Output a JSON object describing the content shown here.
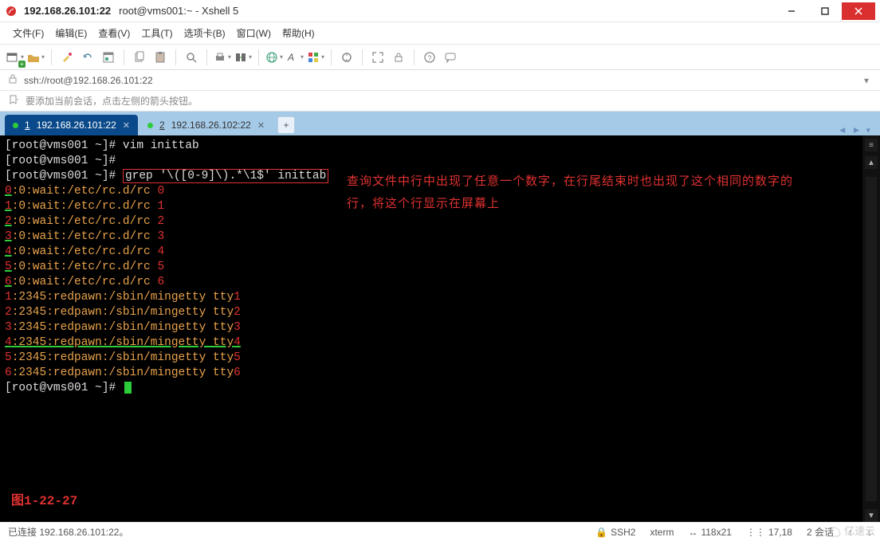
{
  "window": {
    "ip_bold": "192.168.26.101:22",
    "title_rest": "root@vms001:~ - Xshell 5"
  },
  "menu": {
    "file": "文件(F)",
    "edit": "编辑(E)",
    "view": "查看(V)",
    "tools": "工具(T)",
    "tabs": "选项卡(B)",
    "window": "窗口(W)",
    "help": "帮助(H)"
  },
  "toolbar_icons": [
    "new-session-icon",
    "open-icon",
    "sep",
    "paint-icon",
    "reconnect-icon",
    "properties-icon",
    "sep",
    "copy-icon",
    "paste-icon",
    "sep",
    "find-icon",
    "sep",
    "print-icon",
    "transfer-icon",
    "sep",
    "globe-icon",
    "font-icon",
    "color-icon",
    "sep",
    "refresh-icon",
    "sep",
    "fullscreen-icon",
    "lock-icon",
    "sep",
    "help-icon",
    "chat-icon"
  ],
  "address": {
    "scheme_icon": "lock-icon",
    "url": "ssh://root@192.168.26.101:22"
  },
  "hint": {
    "icon": "bookmark-arrow-icon",
    "text": "要添加当前会话，点击左侧的箭头按钮。"
  },
  "tabs": {
    "items": [
      {
        "dot": true,
        "idx": "1",
        "label": "192.168.26.101:22",
        "active": true
      },
      {
        "dot": true,
        "idx": "2",
        "label": "192.168.26.102:22",
        "active": false
      }
    ]
  },
  "terminal": {
    "lines": [
      {
        "type": "plain",
        "text": "[root@vms001 ~]# vim inittab"
      },
      {
        "type": "plain",
        "text": "[root@vms001 ~]#"
      },
      {
        "type": "boxed",
        "prefix": "[root@vms001 ~]# ",
        "cmd": "grep '\\([0-9]\\).*\\1$' inittab"
      },
      {
        "type": "rc",
        "n": "0"
      },
      {
        "type": "rc",
        "n": "1"
      },
      {
        "type": "rc",
        "n": "2"
      },
      {
        "type": "rc",
        "n": "3"
      },
      {
        "type": "rc",
        "n": "4"
      },
      {
        "type": "rc",
        "n": "5"
      },
      {
        "type": "rc",
        "n": "6"
      },
      {
        "type": "tty",
        "n": "1"
      },
      {
        "type": "tty",
        "n": "2"
      },
      {
        "type": "tty",
        "n": "3"
      },
      {
        "type": "tty_u",
        "n": "4"
      },
      {
        "type": "tty",
        "n": "5"
      },
      {
        "type": "tty",
        "n": "6"
      },
      {
        "type": "prompt_cursor",
        "text": "[root@vms001 ~]# "
      }
    ],
    "annotation_line1": "查询文件中行中出现了任意一个数字，在行尾结束时也出现了这个相同的数字的",
    "annotation_line2": "行，将这个行显示在屏幕上",
    "figure_label": "图1-22-27"
  },
  "status": {
    "left": "已连接 192.168.26.101:22。",
    "ssh": "SSH2",
    "term": "xterm",
    "size": "118x21",
    "pos": "17,18",
    "sessions_label": "2 会话",
    "size_icon": "↔",
    "pos_icon": "⋮⋮",
    "lock_icon": "🔒",
    "up": "↑",
    "down": "↓"
  },
  "watermark": {
    "text": "亿速云"
  }
}
